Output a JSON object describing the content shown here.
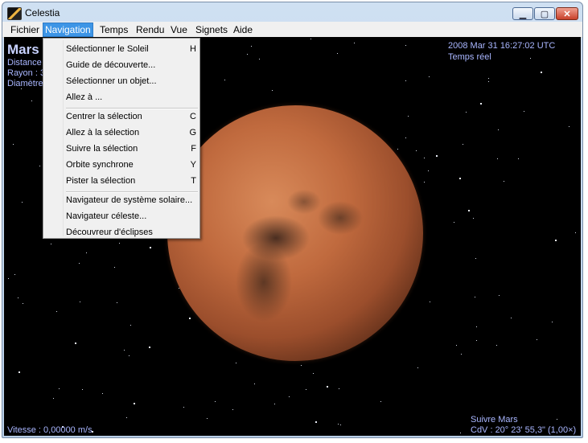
{
  "window": {
    "title": "Celestia"
  },
  "titlebar": {
    "minimize": "▁",
    "maximize": "▢",
    "close": "✕"
  },
  "menu": [
    "Fichier",
    "Navigation",
    "Temps",
    "Rendu",
    "Vue",
    "Signets",
    "Aide"
  ],
  "menu_active_index": 1,
  "hud": {
    "object_name": "Mars",
    "distance": "Distance",
    "radius": "Rayon : 3",
    "diameter": "Diamètre",
    "datetime": "2008 Mar 31 16:27:02 UTC",
    "time_mode": "Temps réel",
    "speed": "Vitesse : 0,00000 m/s",
    "follow": "Suivre Mars",
    "fov": "CdV : 20° 23' 55,3\" (1,00×)"
  },
  "navigation_menu": {
    "groups": [
      [
        {
          "label": "Sélectionner le Soleil",
          "shortcut": "H"
        },
        {
          "label": "Guide de découverte...",
          "shortcut": ""
        },
        {
          "label": "Sélectionner un objet...",
          "shortcut": ""
        },
        {
          "label": "Allez à ...",
          "shortcut": ""
        }
      ],
      [
        {
          "label": "Centrer la sélection",
          "shortcut": "C"
        },
        {
          "label": "Allez à la sélection",
          "shortcut": "G"
        },
        {
          "label": "Suivre la sélection",
          "shortcut": "F"
        },
        {
          "label": "Orbite synchrone",
          "shortcut": "Y"
        },
        {
          "label": "Pister la sélection",
          "shortcut": "T"
        }
      ],
      [
        {
          "label": "Navigateur de système solaire...",
          "shortcut": ""
        },
        {
          "label": "Navigateur céleste...",
          "shortcut": ""
        },
        {
          "label": "Découvreur d'éclipses",
          "shortcut": ""
        }
      ]
    ]
  },
  "colors": {
    "hud_text": "#a9b6ff",
    "menu_highlight": "#3d95e6",
    "space": "#000000"
  }
}
